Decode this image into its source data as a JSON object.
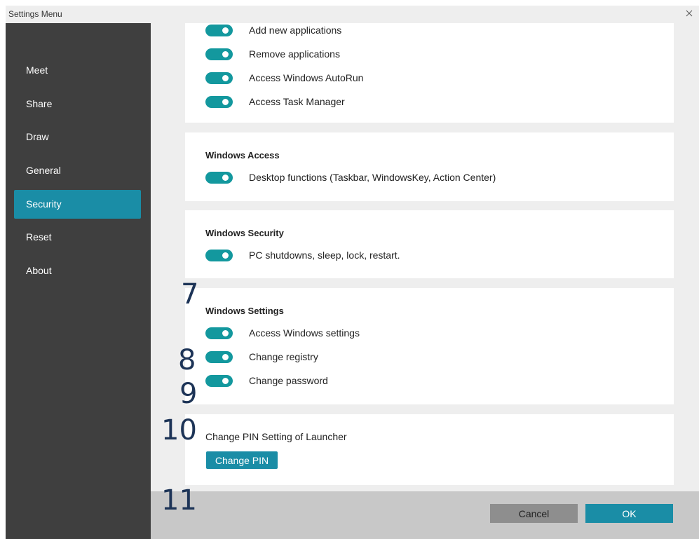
{
  "window": {
    "title": "Settings Menu"
  },
  "sidebar": {
    "items": [
      {
        "label": "Meet"
      },
      {
        "label": "Share"
      },
      {
        "label": "Draw"
      },
      {
        "label": "General"
      },
      {
        "label": "Security",
        "active": true
      },
      {
        "label": "Reset"
      },
      {
        "label": "About"
      }
    ]
  },
  "sections": {
    "applications": {
      "items": [
        {
          "label": "Add new applications",
          "enabled": true
        },
        {
          "label": "Remove applications",
          "enabled": true
        },
        {
          "label": "Access Windows AutoRun",
          "enabled": true
        },
        {
          "label": "Access Task Manager",
          "enabled": true
        }
      ]
    },
    "windows_access": {
      "title": "Windows Access",
      "items": [
        {
          "label": "Desktop functions (Taskbar, WindowsKey, Action Center)",
          "enabled": true
        }
      ]
    },
    "windows_security": {
      "title": "Windows Security",
      "items": [
        {
          "label": "PC shutdowns, sleep, lock, restart.",
          "enabled": true
        }
      ]
    },
    "windows_settings": {
      "title": "Windows Settings",
      "items": [
        {
          "label": "Access Windows settings",
          "enabled": true
        },
        {
          "label": "Change registry",
          "enabled": true
        },
        {
          "label": "Change password",
          "enabled": true
        }
      ]
    },
    "pin": {
      "label": "Change PIN Setting of Launcher",
      "button": "Change PIN"
    }
  },
  "annotations": [
    "7",
    "8",
    "9",
    "10",
    "11"
  ],
  "footer": {
    "cancel": "Cancel",
    "ok": "OK"
  },
  "colors": {
    "accent": "#1a8da6",
    "toggle": "#13989e",
    "sidebar": "#3f3f3f"
  }
}
